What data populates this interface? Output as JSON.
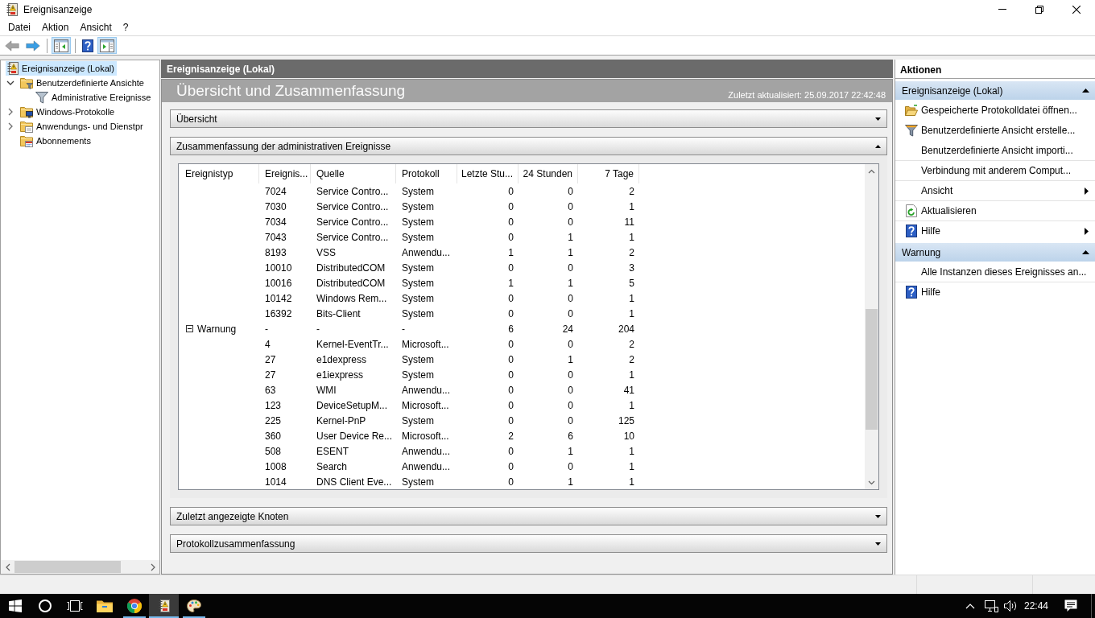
{
  "window": {
    "title": "Ereignisanzeige"
  },
  "menu": [
    "Datei",
    "Aktion",
    "Ansicht",
    "?"
  ],
  "toolbar": [
    {
      "kind": "back",
      "disabled": true
    },
    {
      "kind": "forward",
      "disabled": false
    },
    {
      "kind": "separator"
    },
    {
      "kind": "console-tree",
      "pressed": true
    },
    {
      "kind": "separator"
    },
    {
      "kind": "help",
      "pressed": false
    },
    {
      "kind": "action-pane",
      "pressed": true
    }
  ],
  "tree": [
    {
      "label": "Ereignisanzeige (Lokal)",
      "kind": "root",
      "selected": true,
      "children": [
        {
          "label": "Benutzerdefinierte Ansichte",
          "kind": "custom-views",
          "selected": false,
          "expanded": true,
          "children": [
            {
              "label": "Administrative Ereignisse",
              "kind": "filter",
              "selected": false
            }
          ]
        },
        {
          "label": "Windows-Protokolle",
          "kind": "windows-logs",
          "selected": false,
          "expanded": false
        },
        {
          "label": "Anwendungs- und Dienstpr",
          "kind": "app-logs",
          "selected": false,
          "expanded": false
        },
        {
          "label": "Abonnements",
          "kind": "subscriptions",
          "selected": false
        }
      ]
    }
  ],
  "main": {
    "header": "Ereignisanzeige (Lokal)",
    "title": "Übersicht und Zusammenfassung",
    "updated": "Zuletzt aktualisiert: 25.09.2017 22:42:48",
    "sections": [
      {
        "title": "Übersicht",
        "expanded": false
      },
      {
        "title": "Zusammenfassung der administrativen Ereignisse",
        "expanded": true,
        "table": {
          "columns": [
            "Ereignistyp",
            "Ereignis...",
            "Quelle",
            "Protokoll",
            "Letzte Stu...",
            "24 Stunden",
            "7 Tage"
          ],
          "rows": [
            {
              "kind": "event",
              "event_id": "7024",
              "source": "Service Contro...",
              "log": "System",
              "last_hour": "0",
              "last_24_hours": "0",
              "last_7_days": "2"
            },
            {
              "kind": "event",
              "event_id": "7030",
              "source": "Service Contro...",
              "log": "System",
              "last_hour": "0",
              "last_24_hours": "0",
              "last_7_days": "1"
            },
            {
              "kind": "event",
              "event_id": "7034",
              "source": "Service Contro...",
              "log": "System",
              "last_hour": "0",
              "last_24_hours": "0",
              "last_7_days": "11"
            },
            {
              "kind": "event",
              "event_id": "7043",
              "source": "Service Contro...",
              "log": "System",
              "last_hour": "0",
              "last_24_hours": "1",
              "last_7_days": "1"
            },
            {
              "kind": "event",
              "event_id": "8193",
              "source": "VSS",
              "log": "Anwendu...",
              "last_hour": "1",
              "last_24_hours": "1",
              "last_7_days": "2"
            },
            {
              "kind": "event",
              "event_id": "10010",
              "source": "DistributedCOM",
              "log": "System",
              "last_hour": "0",
              "last_24_hours": "0",
              "last_7_days": "3"
            },
            {
              "kind": "event",
              "event_id": "10016",
              "source": "DistributedCOM",
              "log": "System",
              "last_hour": "1",
              "last_24_hours": "1",
              "last_7_days": "5"
            },
            {
              "kind": "event",
              "event_id": "10142",
              "source": "Windows Rem...",
              "log": "System",
              "last_hour": "0",
              "last_24_hours": "0",
              "last_7_days": "1"
            },
            {
              "kind": "event",
              "event_id": "16392",
              "source": "Bits-Client",
              "log": "System",
              "last_hour": "0",
              "last_24_hours": "0",
              "last_7_days": "1"
            },
            {
              "kind": "group",
              "event_type": "Warnung",
              "expanded": true,
              "event_id": "-",
              "source": "-",
              "log": "-",
              "last_hour": "6",
              "last_24_hours": "24",
              "last_7_days": "204"
            },
            {
              "kind": "event",
              "event_id": "4",
              "source": "Kernel-EventTr...",
              "log": "Microsoft...",
              "last_hour": "0",
              "last_24_hours": "0",
              "last_7_days": "2"
            },
            {
              "kind": "event",
              "event_id": "27",
              "source": "e1dexpress",
              "log": "System",
              "last_hour": "0",
              "last_24_hours": "1",
              "last_7_days": "2"
            },
            {
              "kind": "event",
              "event_id": "27",
              "source": "e1iexpress",
              "log": "System",
              "last_hour": "0",
              "last_24_hours": "0",
              "last_7_days": "1"
            },
            {
              "kind": "event",
              "event_id": "63",
              "source": "WMI",
              "log": "Anwendu...",
              "last_hour": "0",
              "last_24_hours": "0",
              "last_7_days": "41"
            },
            {
              "kind": "event",
              "event_id": "123",
              "source": "DeviceSetupM...",
              "log": "Microsoft...",
              "last_hour": "0",
              "last_24_hours": "0",
              "last_7_days": "1"
            },
            {
              "kind": "event",
              "event_id": "225",
              "source": "Kernel-PnP",
              "log": "System",
              "last_hour": "0",
              "last_24_hours": "0",
              "last_7_days": "125"
            },
            {
              "kind": "event",
              "event_id": "360",
              "source": "User Device Re...",
              "log": "Microsoft...",
              "last_hour": "2",
              "last_24_hours": "6",
              "last_7_days": "10"
            },
            {
              "kind": "event",
              "event_id": "508",
              "source": "ESENT",
              "log": "Anwendu...",
              "last_hour": "0",
              "last_24_hours": "1",
              "last_7_days": "1"
            },
            {
              "kind": "event",
              "event_id": "1008",
              "source": "Search",
              "log": "Anwendu...",
              "last_hour": "0",
              "last_24_hours": "0",
              "last_7_days": "1"
            },
            {
              "kind": "event",
              "event_id": "1014",
              "source": "DNS Client Eve...",
              "log": "System",
              "last_hour": "0",
              "last_24_hours": "1",
              "last_7_days": "1"
            }
          ]
        }
      },
      {
        "title": "Zuletzt angezeigte Knoten",
        "expanded": false
      },
      {
        "title": "Protokollzusammenfassung",
        "expanded": false
      }
    ]
  },
  "actions": {
    "title": "Aktionen",
    "sections": [
      {
        "title": "Ereignisanzeige (Lokal)",
        "expanded": true,
        "items": [
          {
            "label": "Gespeicherte Protokolldatei öffnen...",
            "kind": "open",
            "submenu": false,
            "divider": false
          },
          {
            "label": "Benutzerdefinierte Ansicht erstelle...",
            "kind": "filter",
            "submenu": false,
            "divider": false
          },
          {
            "label": "Benutzerdefinierte Ansicht importi...",
            "kind": "plain",
            "submenu": false,
            "divider": false
          },
          {
            "label": "Verbindung mit anderem Comput...",
            "kind": "plain",
            "submenu": false,
            "divider": true
          },
          {
            "label": "Ansicht",
            "kind": "plain",
            "submenu": true,
            "divider": true
          },
          {
            "label": "Aktualisieren",
            "kind": "refresh",
            "submenu": false,
            "divider": true
          },
          {
            "label": "Hilfe",
            "kind": "help",
            "submenu": true,
            "divider": true
          }
        ]
      },
      {
        "title": "Warnung",
        "expanded": true,
        "items": [
          {
            "label": "Alle Instanzen dieses Ereignisses an...",
            "kind": "plain",
            "submenu": false,
            "divider": false
          },
          {
            "label": "Hilfe",
            "kind": "help",
            "submenu": false,
            "divider": true
          }
        ]
      }
    ]
  },
  "taskbar": {
    "buttons": [
      {
        "kind": "start"
      },
      {
        "kind": "search"
      },
      {
        "kind": "task-view"
      }
    ],
    "apps": [
      {
        "kind": "explorer",
        "running": false,
        "active": false
      },
      {
        "kind": "browser",
        "running": true,
        "active": false
      },
      {
        "kind": "eventviewer",
        "running": true,
        "active": true
      },
      {
        "kind": "paint",
        "running": true,
        "active": false
      }
    ],
    "tray": [
      {
        "kind": "overflow"
      },
      {
        "kind": "network"
      },
      {
        "kind": "volume"
      }
    ],
    "clock": "22:44"
  }
}
